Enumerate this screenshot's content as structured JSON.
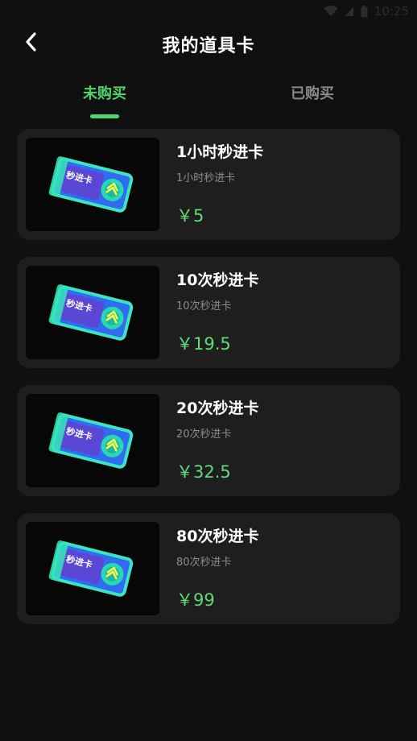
{
  "status_bar": {
    "time": "10:25",
    "icons": [
      "wifi-icon",
      "signal-icon",
      "battery-icon"
    ]
  },
  "header": {
    "title": "我的道具卡",
    "back_icon": "chevron-left-icon"
  },
  "tabs": [
    {
      "label": "未购买",
      "active": true
    },
    {
      "label": "已购买",
      "active": false
    }
  ],
  "items": [
    {
      "title": "1小时秒进卡",
      "subtitle": "1小时秒进卡",
      "price": "￥5"
    },
    {
      "title": "10次秒进卡",
      "subtitle": "10次秒进卡",
      "price": "￥19.5"
    },
    {
      "title": "20次秒进卡",
      "subtitle": "20次秒进卡",
      "price": "￥32.5"
    },
    {
      "title": "80次秒进卡",
      "subtitle": "80次秒进卡",
      "price": "￥99"
    }
  ],
  "card_art_text": "秒进卡",
  "colors": {
    "background": "#101010",
    "card": "#1e1e1e",
    "accent_green": "#4fd66a",
    "price_green": "#5fdc78",
    "inactive_tab": "#8a8a8a"
  }
}
